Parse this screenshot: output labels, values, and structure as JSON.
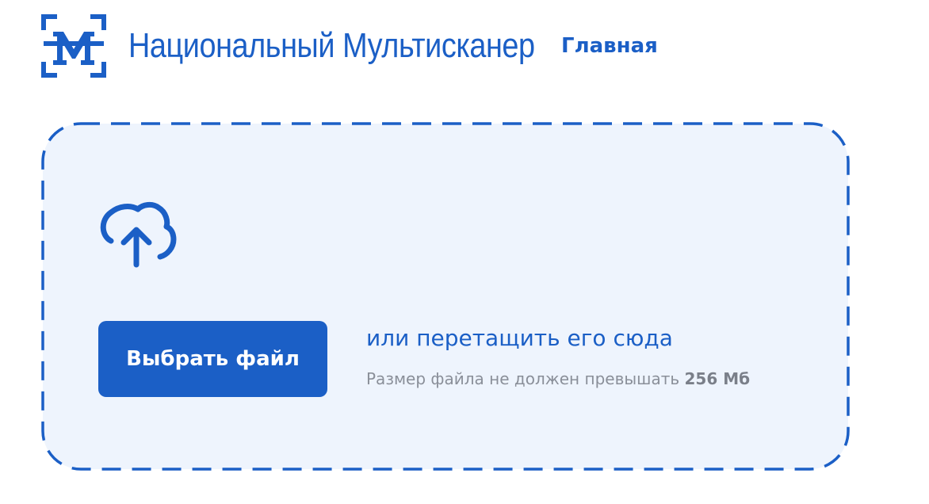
{
  "header": {
    "brand_name": "Национальный Мультисканер",
    "nav_home": "Главная"
  },
  "upload": {
    "choose_button_label": "Выбрать файл",
    "drag_hint": "или перетащить его сюда",
    "size_hint_prefix": "Размер файла не должен превышать",
    "size_limit": "256 Мб"
  },
  "colors": {
    "accent": "#1b5fc6",
    "dropzone_background": "#eef4fd",
    "muted_text": "#8a8f99"
  },
  "icons": {
    "logo": "scanner-m-logo",
    "upload": "cloud-upload-icon"
  }
}
